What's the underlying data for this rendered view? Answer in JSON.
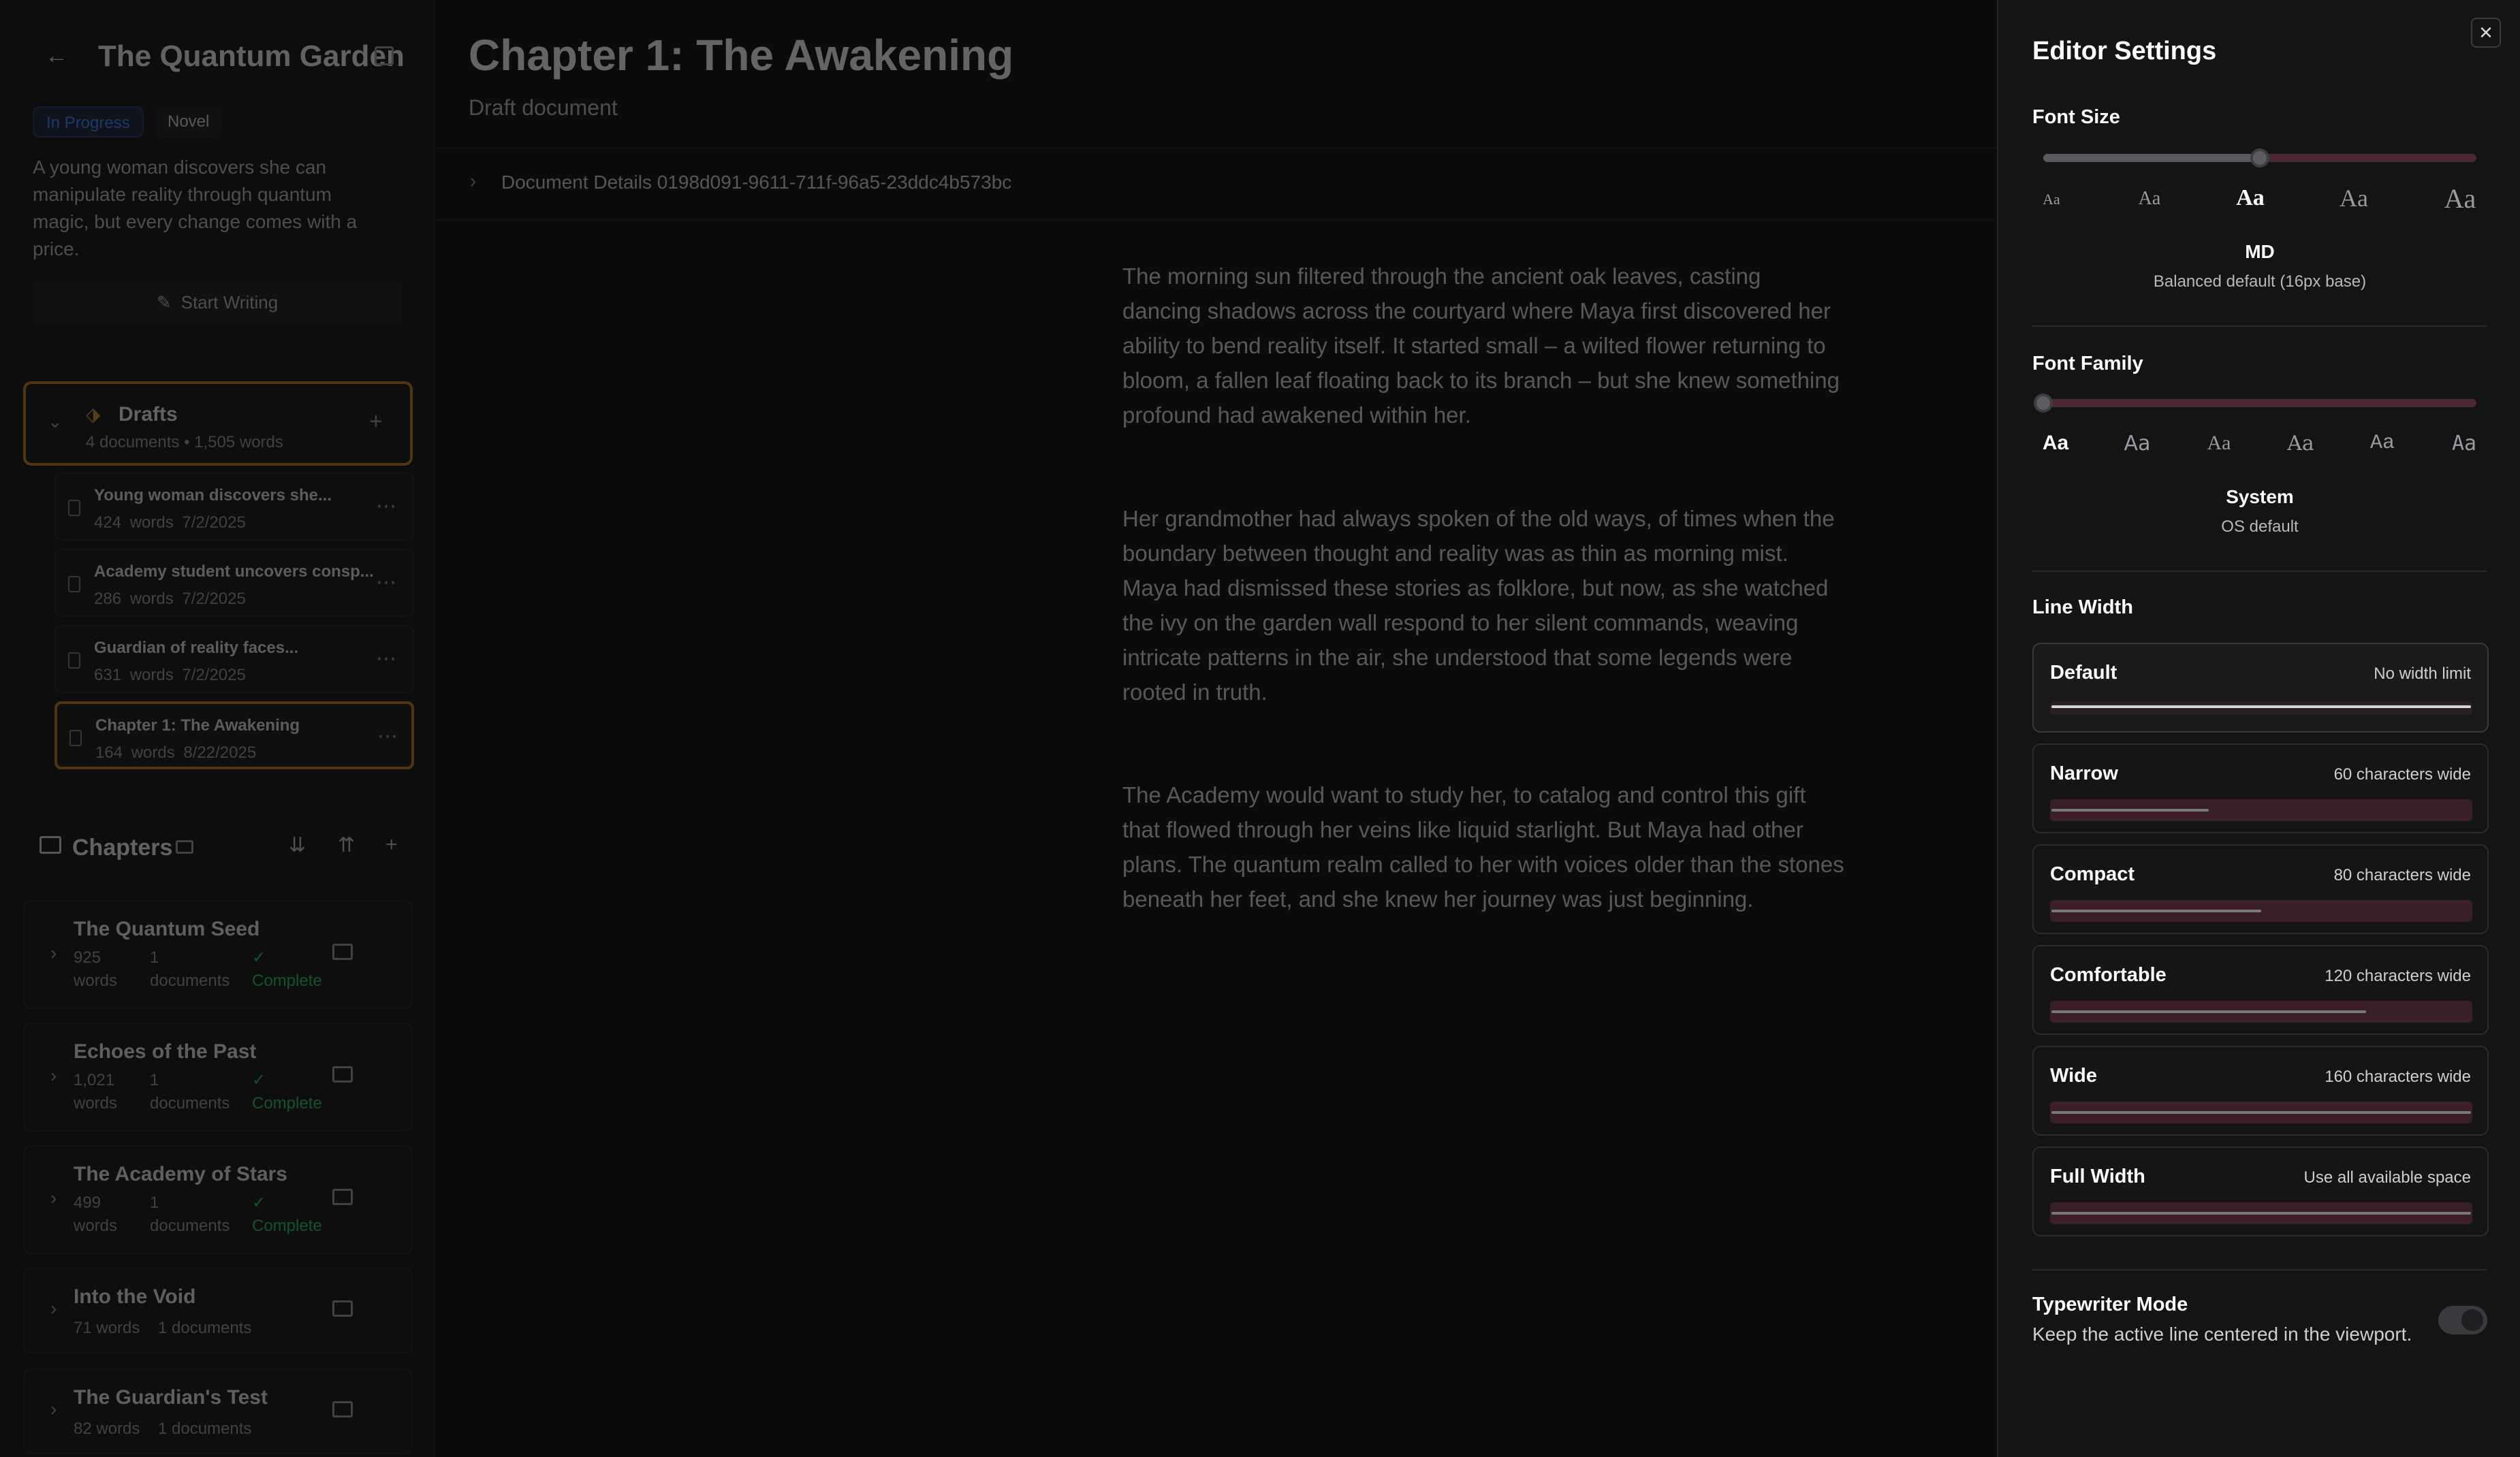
{
  "project": {
    "title": "The Quantum Garden",
    "badges": [
      "In Progress",
      "Novel"
    ],
    "description": "A young woman discovers she can manipulate reality through quantum magic, but every change comes with a price.",
    "start_writing_label": "Start Writing"
  },
  "drafts": {
    "title": "Drafts",
    "meta": "4 documents • 1,505 words",
    "items": [
      {
        "title": "Young woman discovers she...",
        "words": "424 words",
        "date": "7/2/2025"
      },
      {
        "title": "Academy student uncovers consp...",
        "words": "286 words",
        "date": "7/2/2025"
      },
      {
        "title": "Guardian of reality faces...",
        "words": "631 words",
        "date": "7/2/2025"
      },
      {
        "title": "Chapter 1: The Awakening",
        "words": "164 words",
        "date": "8/22/2025"
      }
    ]
  },
  "chapters": {
    "title": "Chapters",
    "items": [
      {
        "title": "The Quantum Seed",
        "words_num": "925",
        "words_unit": "words",
        "docs_num": "1",
        "docs_unit": "documents",
        "status": "Complete"
      },
      {
        "title": "Echoes of the Past",
        "words_num": "1,021",
        "words_unit": "words",
        "docs_num": "1",
        "docs_unit": "documents",
        "status": "Complete"
      },
      {
        "title": "The Academy of Stars",
        "words_num": "499",
        "words_unit": "words",
        "docs_num": "1",
        "docs_unit": "documents",
        "status": "Complete"
      },
      {
        "title": "Into the Void",
        "words": "71 words",
        "docs": "1 documents"
      },
      {
        "title": "The Guardian's Test",
        "words": "82 words",
        "docs": "1 documents"
      }
    ]
  },
  "document": {
    "title": "Chapter 1: The Awakening",
    "subtitle": "Draft document",
    "details_label": "Document Details 0198d091-9611-711f-96a5-23ddc4b573bc",
    "paragraphs": [
      "The morning sun filtered through the ancient oak leaves, casting dancing shadows across the courtyard where Maya first discovered her ability to bend reality itself. It started small – a wilted flower returning to bloom, a fallen leaf floating back to its branch – but she knew something profound had awakened within her.",
      "Her grandmother had always spoken of the old ways, of times when the boundary between thought and reality was as thin as morning mist. Maya had dismissed these stories as folklore, but now, as she watched the ivy on the garden wall respond to her silent commands, weaving intricate patterns in the air, she understood that some legends were rooted in truth.",
      "The Academy would want to study her, to catalog and control this gift that flowed through her veins like liquid starlight. But Maya had other plans. The quantum realm called to her with voices older than the stones beneath her feet, and she knew her journey was just beginning."
    ]
  },
  "settings": {
    "title": "Editor Settings",
    "font_size": {
      "label": "Font Size",
      "options": [
        "Aa",
        "Aa",
        "Aa",
        "Aa",
        "Aa"
      ],
      "selected_index": 2,
      "selected_fraction": 0.5,
      "selected_name": "MD",
      "selected_desc": "Balanced default (16px base)"
    },
    "font_family": {
      "label": "Font Family",
      "options": [
        "Aa",
        "Aa",
        "Aa",
        "Aa",
        "Aa",
        "Aa"
      ],
      "selected_index": 0,
      "selected_fraction": 0.0,
      "selected_name": "System",
      "selected_desc": "OS default"
    },
    "line_width": {
      "label": "Line Width",
      "selected": "Default",
      "options": [
        {
          "name": "Default",
          "desc": "No width limit",
          "fraction": 1.0
        },
        {
          "name": "Narrow",
          "desc": "60 characters wide",
          "fraction": 0.375
        },
        {
          "name": "Compact",
          "desc": "80 characters wide",
          "fraction": 0.5
        },
        {
          "name": "Comfortable",
          "desc": "120 characters wide",
          "fraction": 0.75
        },
        {
          "name": "Wide",
          "desc": "160 characters wide",
          "fraction": 1.0
        },
        {
          "name": "Full Width",
          "desc": "Use all available space",
          "fraction": 1.0
        }
      ]
    },
    "typewriter": {
      "label": "Typewriter Mode",
      "desc": "Keep the active line centered in the viewport.",
      "enabled": false
    }
  },
  "colors": {
    "accent_amber": "#c47a1a",
    "status_green": "#22c55e",
    "badge_blue": "#3b82f6",
    "slider_track": "#4a2833"
  },
  "icons": {
    "back": "arrow-left-icon",
    "close": "x-icon",
    "more": "ellipsis-icon",
    "chevron": "chevron-right-icon",
    "book": "book-icon",
    "tag": "tag-icon",
    "pen": "pen-icon"
  }
}
